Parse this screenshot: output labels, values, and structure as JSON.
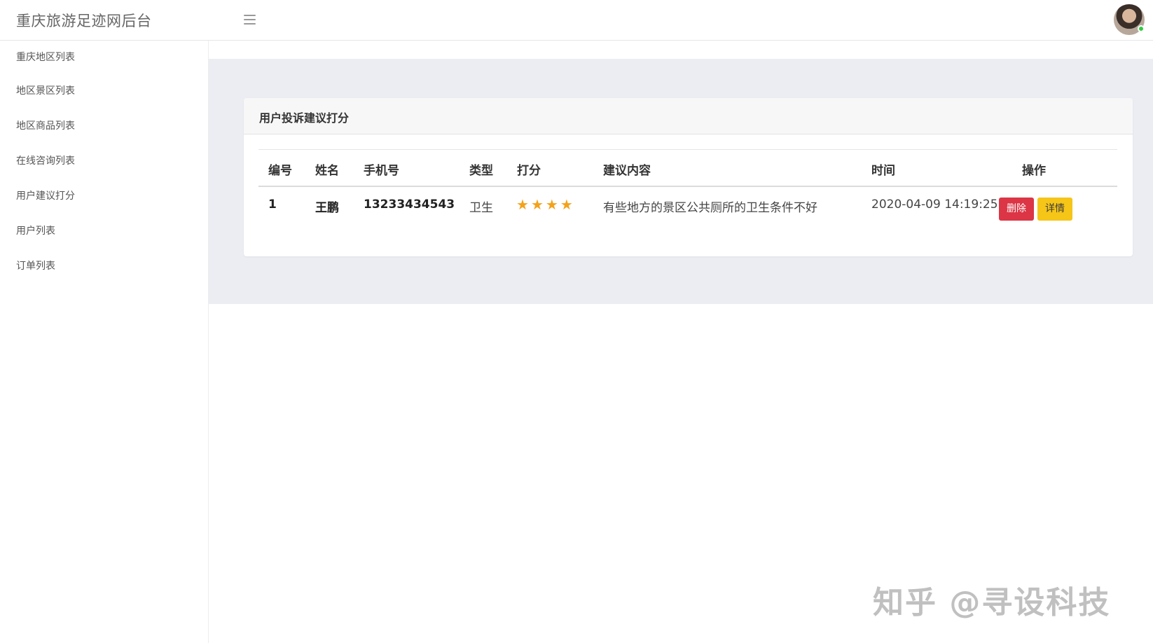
{
  "header": {
    "brand": "重庆旅游足迹网后台",
    "menu_icon": "hamburger-menu-icon",
    "avatar_icon": "user-avatar"
  },
  "sidebar": {
    "items": [
      {
        "label": "重庆地区列表"
      },
      {
        "label": "地区景区列表"
      },
      {
        "label": "地区商品列表"
      },
      {
        "label": "在线咨询列表"
      },
      {
        "label": "用户建议打分"
      },
      {
        "label": "用户列表"
      },
      {
        "label": "订单列表"
      }
    ]
  },
  "main": {
    "card_title": "用户投诉建议打分",
    "table": {
      "columns": [
        "编号",
        "姓名",
        "手机号",
        "类型",
        "打分",
        "建议内容",
        "时间",
        "操作"
      ],
      "rows": [
        {
          "id": "1",
          "name": "王鹏",
          "phone": "13233434543",
          "type": "卫生",
          "rating": 4,
          "content": "有些地方的景区公共厕所的卫生条件不好",
          "time": "2020-04-09 14:19:25",
          "delete_label": "删除",
          "detail_label": "详情"
        }
      ]
    }
  },
  "watermark": "知乎 @寻设科技",
  "colors": {
    "content_bg": "#ebedf2",
    "delete_button": "#dc3545",
    "detail_button": "#f5c518",
    "star": "#f3a21b",
    "online_status": "#2ecc40"
  }
}
